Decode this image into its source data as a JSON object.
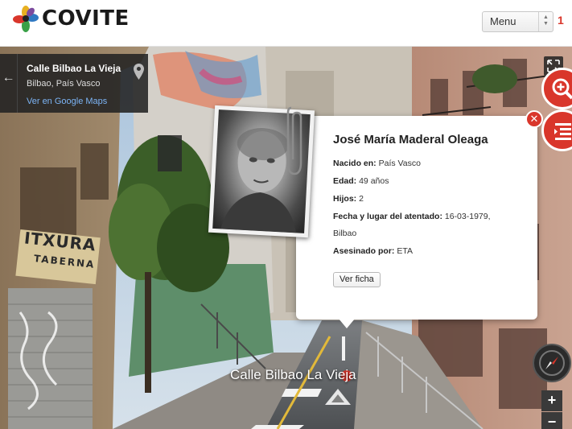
{
  "header": {
    "logo_text": "COVITE",
    "menu_label": "Menu",
    "menu_count": "1"
  },
  "street_view": {
    "title": "Calle Bilbao La Vieja",
    "subtitle": "Bilbao, País Vasco",
    "link": "Ver en Google Maps",
    "street_label": "Calle Bilbao La Vieja",
    "shop_sign": "ITXURA",
    "shop_sign_sub": "TABERNA"
  },
  "popup": {
    "name": "José María Maderal Oleaga",
    "rows": [
      {
        "label": "Nacido en:",
        "value": "País Vasco"
      },
      {
        "label": "Edad:",
        "value": "49 años"
      },
      {
        "label": "Hijos:",
        "value": "2"
      },
      {
        "label": "Fecha y lugar del atentado:",
        "value": "16-03-1979,"
      },
      {
        "label": "",
        "value": "Bilbao"
      },
      {
        "label": "Asesinado por:",
        "value": "ETA"
      }
    ],
    "button": "Ver ficha",
    "close": "✕"
  },
  "controls": {
    "zoom_in": "+",
    "zoom_out": "−"
  },
  "colors": {
    "accent": "#d9362b",
    "link": "#7cb4f5"
  }
}
